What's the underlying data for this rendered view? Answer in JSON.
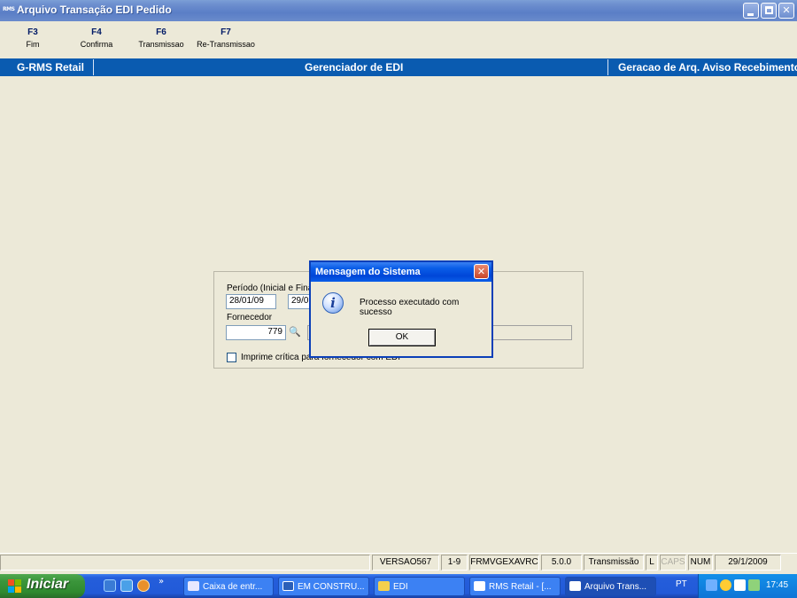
{
  "window": {
    "app_icon": "RMS",
    "title": "Arquivo Transação EDI Pedido",
    "controls": [
      "minimize-icon",
      "restore-icon",
      "close-icon"
    ]
  },
  "function_keys": [
    {
      "key": "F3",
      "label": "Fim"
    },
    {
      "key": "F4",
      "label": "Confirma"
    },
    {
      "key": "F6",
      "label": "Transmissao"
    },
    {
      "key": "F7",
      "label": "Re-Transmissao"
    }
  ],
  "header_band": {
    "left": "G-RMS Retail",
    "center": "Gerenciador de EDI",
    "right": "Geracao de Arq. Aviso Recebimento"
  },
  "form": {
    "period_label": "Período (Inicial e Final)",
    "period_start": "28/01/09",
    "period_end_partial": "29/0",
    "supplier_label": "Fornecedor",
    "supplier_code": "779",
    "checkbox_label": "Imprime crítica para fornecedor com EDI",
    "checkbox_checked": false
  },
  "dialog": {
    "title": "Mensagem do Sistema",
    "icon": "info-icon",
    "message": "Processo executado com sucesso",
    "ok_label": "OK"
  },
  "status_bar": {
    "version": "VERSAO567",
    "range": "1-9",
    "form_name": "FRMVGEXAVRC",
    "build": "5.0.0",
    "mode": "Transmissão",
    "l": "L",
    "caps": "CAPS",
    "num": "NUM",
    "date": "29/1/2009"
  },
  "taskbar": {
    "start_label": "Iniciar",
    "tasks": [
      {
        "label": "Caixa de entr...",
        "icon_color": "#e8e8ff"
      },
      {
        "label": "EM CONSTRU...",
        "icon_color": "#2b5fb8"
      },
      {
        "label": "EDI",
        "icon_color": "#f4d04e"
      },
      {
        "label": "RMS Retail - [...",
        "icon_color": "#ffffff"
      },
      {
        "label": "Arquivo Trans...",
        "icon_color": "#ffffff"
      }
    ],
    "language": "PT",
    "clock": "17:45"
  }
}
